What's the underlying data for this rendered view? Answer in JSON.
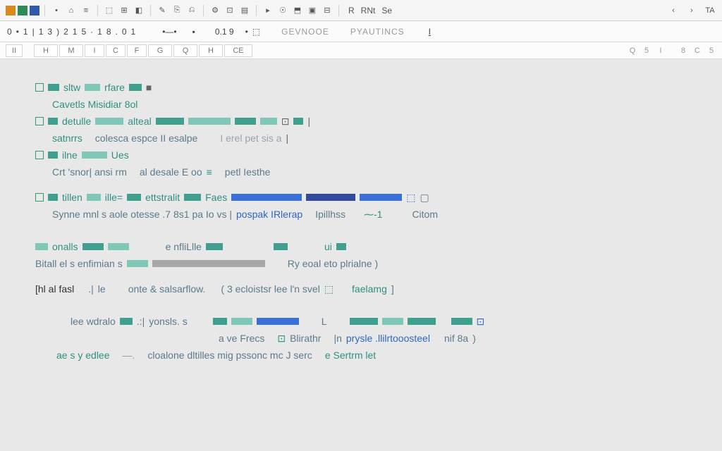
{
  "toolbar1": {
    "swatches": [
      "#d68b1c",
      "#2f8a58",
      "#2e5aa8"
    ],
    "right_labels": [
      "R",
      "RNt",
      "Se"
    ],
    "nav_chev": [
      "‹",
      "›"
    ],
    "nav_misc": "TA"
  },
  "toolbar2": {
    "nums": [
      "0",
      "1",
      "1",
      "3",
      "2",
      "1",
      "5",
      "1",
      "8",
      "0",
      "1"
    ],
    "mid": "0.1 9",
    "tabs": [
      "GEVNOOE",
      "PYAUTINCS"
    ],
    "end": "I"
  },
  "ruler": {
    "firstcol": "II",
    "cols": [
      "H",
      "M",
      "I",
      "C",
      "F",
      "G",
      "Q",
      "H",
      "CE"
    ],
    "right": [
      "Q",
      "5",
      "I",
      "8",
      "C",
      "5"
    ]
  },
  "content": {
    "l1a": "sltw",
    "l1b": "rfare",
    "l2": "Cavetls Misidiar 8ol",
    "l3a": "detulle",
    "l3b": "alteal",
    "l4a": "satnrrs",
    "l4b": "colesca espce II esalpe",
    "l4c": "I erel pet sis a",
    "l5a": "ilne",
    "l5b": "Crt  'snor|  ansi rm",
    "l5c": "al   desale  E oo",
    "l5d": "petl    Iesthe",
    "l6a": "tillen",
    "l6b": "ille=",
    "l6c": "ettstralit",
    "l6d": "Faes",
    "l7a": "Synne mnl s   aole otesse   .7 8s1   pa   Io   vs  |",
    "l7b": "pospak  IRlerap",
    "l7c": "Ipillhss",
    "l7d": "Citom",
    "l8a": "onalls",
    "l8b": "e nfliLlle",
    "l8c": "ui",
    "l9a": "Bitall   el s    enfimian s",
    "l9b": "Ry   eoal    eto  plrialne  )",
    "l10a": "[hl al     fasl",
    "l10b": "le",
    "l10c": "onte & salsarflow.",
    "l10d": "( 3 ecloistsr   lee   l'n   svel",
    "l10e": "faelamg",
    "l11a": "lee   wdralo",
    "l11b": "yonsls.   s",
    "l11c": "L",
    "l12a": "a ve Frecs",
    "l12b": "Blirathr",
    "l12c": "prysle .llilrtooosteel",
    "l12d": "nif 8a",
    "l13a": "ae s  y edlee",
    "l13b": "cloalone   dltilles mig  pssonc mc   J serc",
    "l13c": "e   Sertrm let"
  }
}
